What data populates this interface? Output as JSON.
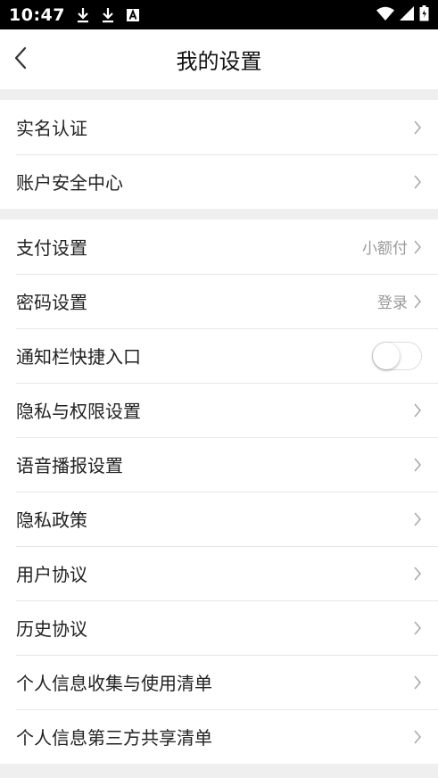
{
  "status_bar": {
    "time": "10:47",
    "icons": [
      "download-icon",
      "download-icon",
      "a-box-icon",
      "wifi-icon",
      "signal-icon",
      "battery-icon"
    ]
  },
  "header": {
    "title": "我的设置",
    "back_icon": "chevron-left-icon"
  },
  "groups": [
    {
      "items": [
        {
          "label": "实名认证"
        },
        {
          "label": "账户安全中心"
        }
      ]
    },
    {
      "items": [
        {
          "label": "支付设置",
          "value": "小额付"
        },
        {
          "label": "密码设置",
          "value": "登录"
        },
        {
          "label": "通知栏快捷入口",
          "toggle": false
        },
        {
          "label": "隐私与权限设置"
        },
        {
          "label": "语音播报设置"
        },
        {
          "label": "隐私政策"
        },
        {
          "label": "用户协议"
        },
        {
          "label": "历史协议"
        },
        {
          "label": "个人信息收集与使用清单"
        },
        {
          "label": "个人信息第三方共享清单"
        }
      ]
    }
  ],
  "colors": {
    "background": "#efefef",
    "divider": "#e6e6e6",
    "value_text": "#999999",
    "chevron": "#aaaaaa"
  }
}
